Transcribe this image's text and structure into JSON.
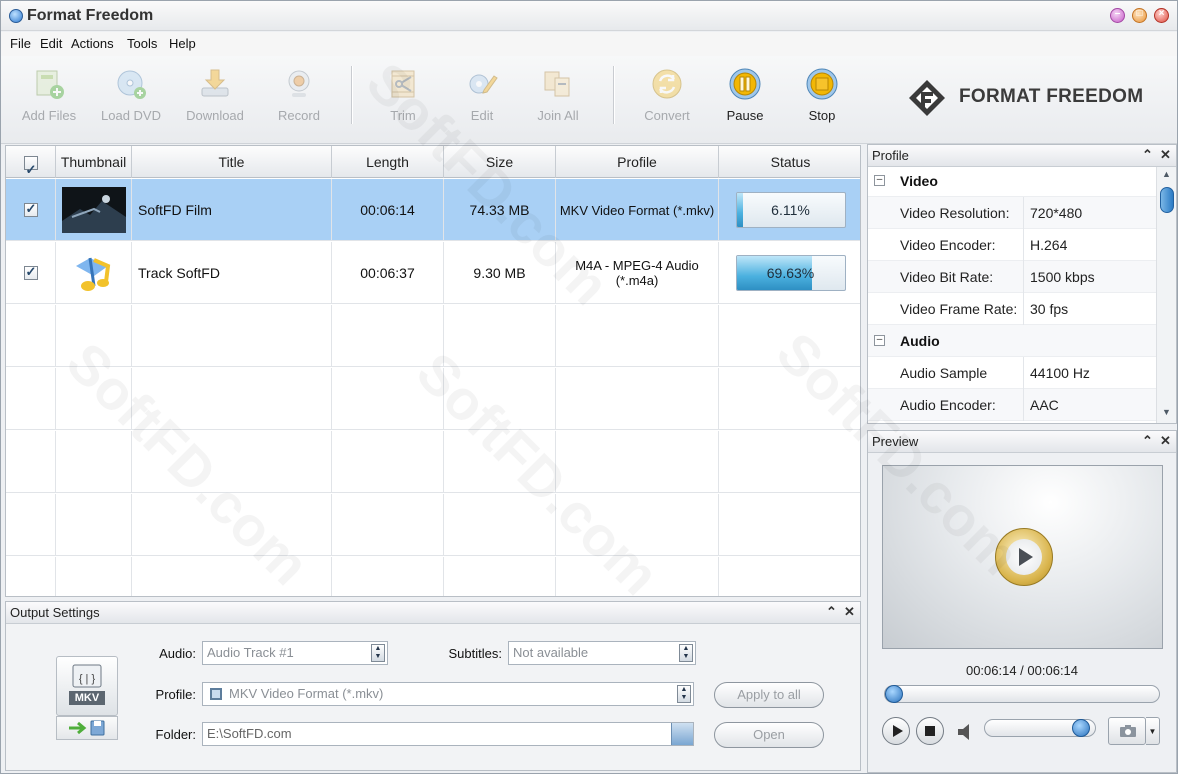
{
  "window": {
    "title": "Format Freedom"
  },
  "menu": [
    "File",
    "Edit",
    "Actions",
    "Tools",
    "Help"
  ],
  "toolbar": {
    "add_files": "Add Files",
    "load_dvd": "Load DVD",
    "download": "Download",
    "record": "Record",
    "trim": "Trim",
    "edit": "Edit",
    "join_all": "Join All",
    "convert": "Convert",
    "pause": "Pause",
    "stop": "Stop",
    "brand": "FORMAT FREEDOM"
  },
  "table": {
    "columns": [
      "Thumbnail",
      "Title",
      "Length",
      "Size",
      "Profile",
      "Status"
    ],
    "rows": [
      {
        "title": "SoftFD Film",
        "length": "00:06:14",
        "size": "74.33 MB",
        "profile": "MKV Video Format (*.mkv)",
        "progress": 6.11,
        "status": "6.11%",
        "selected": true
      },
      {
        "title": "Track SoftFD",
        "length": "00:06:37",
        "size": "9.30 MB",
        "profile": "M4A - MPEG-4 Audio (*.m4a)",
        "progress": 69.63,
        "status": "69.63%",
        "selected": false
      }
    ]
  },
  "output": {
    "title": "Output Settings",
    "audio_label": "Audio:",
    "audio_value": "Audio Track #1",
    "subtitles_label": "Subtitles:",
    "subtitles_value": "Not available",
    "profile_label": "Profile:",
    "profile_value": "MKV Video Format (*.mkv)",
    "folder_label": "Folder:",
    "folder_value": "E:\\SoftFD.com",
    "apply_all": "Apply to all",
    "open": "Open",
    "format_badge": "MKV"
  },
  "profile": {
    "title": "Profile",
    "video_group": "Video",
    "audio_group": "Audio",
    "video": [
      {
        "key": "Video Resolution:",
        "value": "720*480"
      },
      {
        "key": "Video Encoder:",
        "value": "H.264"
      },
      {
        "key": "Video Bit Rate:",
        "value": "1500 kbps"
      },
      {
        "key": "Video Frame Rate:",
        "value": "30 fps"
      }
    ],
    "audio": [
      {
        "key": "Audio Sample Rate:",
        "value": "44100 Hz"
      },
      {
        "key": "Audio Encoder:",
        "value": "AAC"
      }
    ]
  },
  "preview": {
    "title": "Preview",
    "time": "00:06:14 / 00:06:14",
    "seek_fraction": 0.0,
    "volume_fraction": 0.95
  },
  "watermark": "SoftFD.com",
  "icons": {
    "panel_pin": "double-chevron-up-icon",
    "panel_close": "close-icon"
  },
  "colors": {
    "selection": "#a9d0f5",
    "progress": "#4ab0df",
    "accent_pause_stop": "#f2b705"
  }
}
